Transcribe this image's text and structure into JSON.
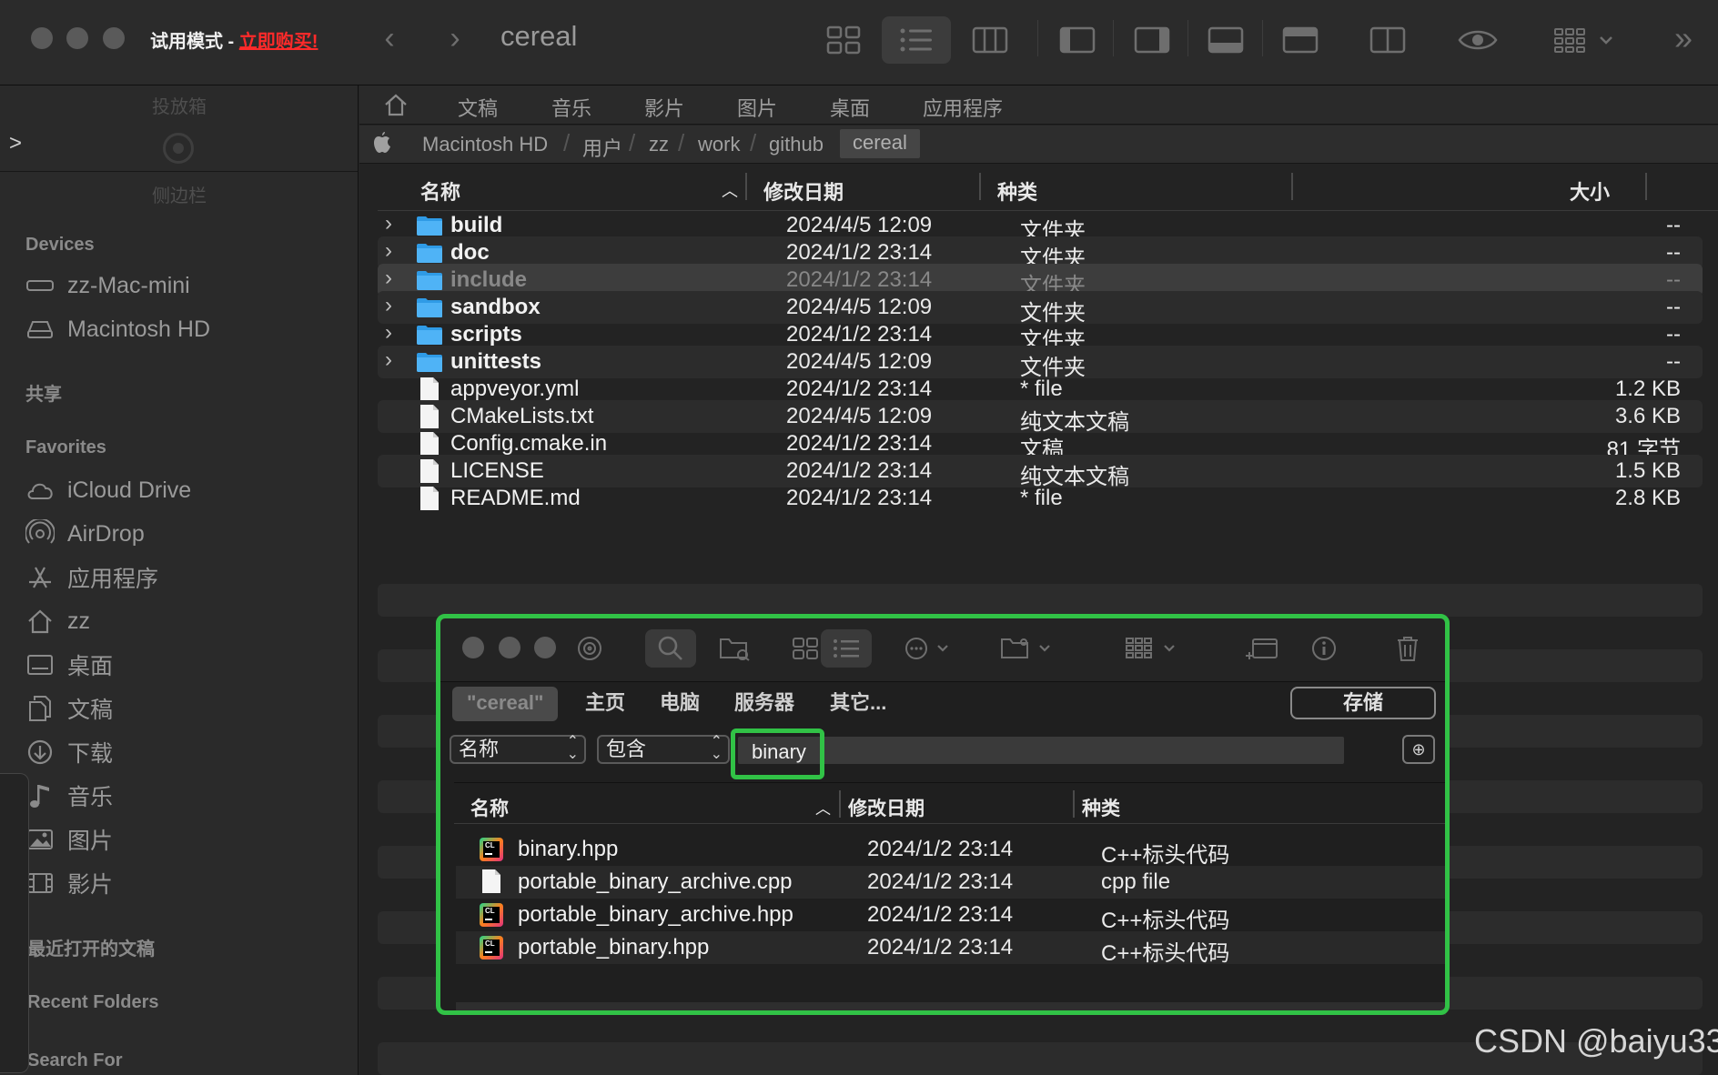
{
  "toolbar": {
    "trial_label": "试用模式 - ",
    "buy_label": "立即购买!",
    "window_title": "cereal",
    "back_glyph": "‹",
    "forward_glyph": "›",
    "more_glyph": "»"
  },
  "sidebar": {
    "dropbox_label": "投放箱",
    "sidebar_label": "侧边栏",
    "sections": {
      "devices": "Devices",
      "shared": "共享",
      "favorites": "Favorites",
      "recent_docs": "最近打开的文稿",
      "recent_folders": "Recent Folders",
      "search_for": "Search For"
    },
    "devices": [
      {
        "label": "zz-Mac-mini",
        "icon": "mac-mini-icon"
      },
      {
        "label": "Macintosh HD",
        "icon": "hard-drive-icon"
      }
    ],
    "favorites": [
      {
        "label": "iCloud Drive",
        "icon": "icloud-icon"
      },
      {
        "label": "AirDrop",
        "icon": "airdrop-icon"
      },
      {
        "label": "应用程序",
        "icon": "applications-icon"
      },
      {
        "label": "zz",
        "icon": "home-icon"
      },
      {
        "label": "桌面",
        "icon": "desktop-icon"
      },
      {
        "label": "文稿",
        "icon": "documents-icon"
      },
      {
        "label": "下载",
        "icon": "downloads-icon"
      },
      {
        "label": "音乐",
        "icon": "music-icon"
      },
      {
        "label": "图片",
        "icon": "pictures-icon"
      },
      {
        "label": "影片",
        "icon": "movies-icon"
      }
    ]
  },
  "tabs": [
    "文稿",
    "音乐",
    "影片",
    "图片",
    "桌面",
    "应用程序"
  ],
  "breadcrumb": [
    "Macintosh HD",
    "用户",
    "zz",
    "work",
    "github",
    "cereal"
  ],
  "columns": {
    "name": "名称",
    "modified": "修改日期",
    "kind": "种类",
    "size": "大小"
  },
  "files": [
    {
      "name": "build",
      "date": "2024/4/5 12:09",
      "kind": "文件夹",
      "size": "--",
      "folder": true
    },
    {
      "name": "doc",
      "date": "2024/1/2 23:14",
      "kind": "文件夹",
      "size": "--",
      "folder": true
    },
    {
      "name": "include",
      "date": "2024/1/2 23:14",
      "kind": "文件夹",
      "size": "--",
      "folder": true,
      "selected": true
    },
    {
      "name": "sandbox",
      "date": "2024/4/5 12:09",
      "kind": "文件夹",
      "size": "--",
      "folder": true
    },
    {
      "name": "scripts",
      "date": "2024/1/2 23:14",
      "kind": "文件夹",
      "size": "--",
      "folder": true
    },
    {
      "name": "unittests",
      "date": "2024/4/5 12:09",
      "kind": "文件夹",
      "size": "--",
      "folder": true
    },
    {
      "name": "appveyor.yml",
      "date": "2024/1/2 23:14",
      "kind": "* file",
      "size": "1.2 KB"
    },
    {
      "name": "CMakeLists.txt",
      "date": "2024/4/5 12:09",
      "kind": "纯文本文稿",
      "size": "3.6 KB"
    },
    {
      "name": "Config.cmake.in",
      "date": "2024/1/2 23:14",
      "kind": "文稿",
      "size": "81 字节"
    },
    {
      "name": "LICENSE",
      "date": "2024/1/2 23:14",
      "kind": "纯文本文稿",
      "size": "1.5 KB"
    },
    {
      "name": "README.md",
      "date": "2024/1/2 23:14",
      "kind": "* file",
      "size": "2.8 KB"
    }
  ],
  "search": {
    "scopes": [
      "\"cereal\"",
      "主页",
      "电脑",
      "服务器",
      "其它..."
    ],
    "save_label": "存储",
    "attribute": "名称",
    "operator": "包含",
    "query": "binary",
    "add_glyph": "⊕",
    "columns": {
      "name": "名称",
      "modified": "修改日期",
      "kind": "种类"
    },
    "results": [
      {
        "name": "binary.hpp",
        "date": "2024/1/2 23:14",
        "kind": "C++标头代码",
        "icon": "clion"
      },
      {
        "name": "portable_binary_archive.cpp",
        "date": "2024/1/2 23:14",
        "kind": "cpp file",
        "icon": "doc"
      },
      {
        "name": "portable_binary_archive.hpp",
        "date": "2024/1/2 23:14",
        "kind": "C++标头代码",
        "icon": "clion"
      },
      {
        "name": "portable_binary.hpp",
        "date": "2024/1/2 23:14",
        "kind": "C++标头代码",
        "icon": "clion"
      }
    ]
  },
  "watermark": "CSDN @baiyu33",
  "colors": {
    "highlight": "#31c246",
    "folder": "#3fa9f5",
    "buy_link": "#ff2a2a"
  }
}
